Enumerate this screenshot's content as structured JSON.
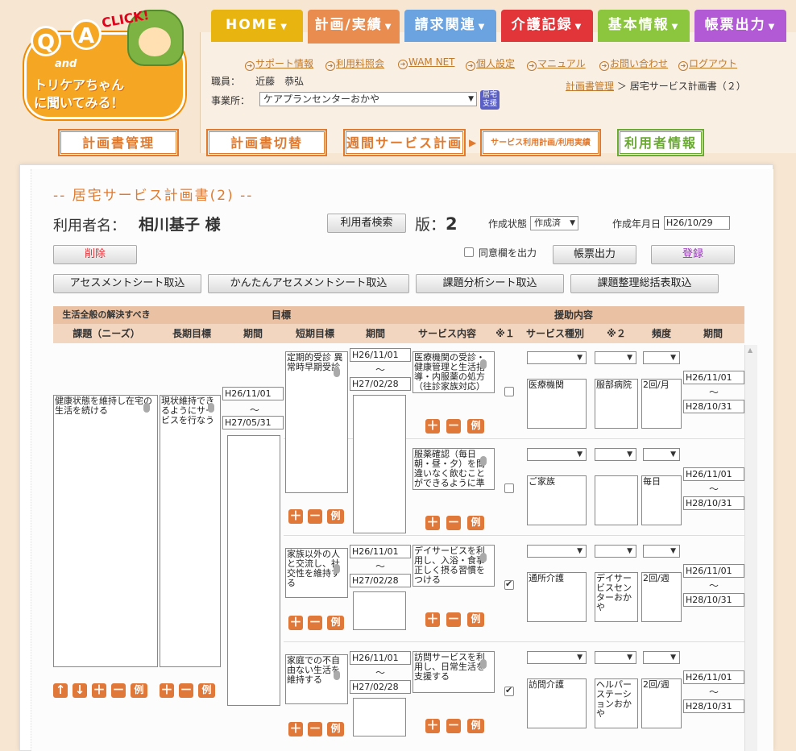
{
  "logo": {
    "q": "Q",
    "a": "A",
    "click": "CLICK!",
    "and": "and",
    "line1": "トリケアちゃん",
    "line2": "に聞いてみる！"
  },
  "tabs": [
    {
      "label": "HOME",
      "color": "#e8b410"
    },
    {
      "label": "計画/実績",
      "color": "#e98c4f"
    },
    {
      "label": "請求関連",
      "color": "#6aa3e0"
    },
    {
      "label": "介護記録",
      "color": "#e2353a"
    },
    {
      "label": "基本情報",
      "color": "#8cc63e"
    },
    {
      "label": "帳票出力",
      "color": "#b259d6"
    }
  ],
  "links": [
    "サポート情報",
    "利用料照会",
    "WAM NET",
    "個人設定",
    "マニュアル",
    "お問い合わせ",
    "ログアウト"
  ],
  "staff": {
    "label": "職員：",
    "name": "近藤　恭弘"
  },
  "office": {
    "label": "事業所：",
    "value": "ケアプランセンターおかや",
    "badge1": "居宅",
    "badge2": "支援"
  },
  "breadcrumb": {
    "parent": "計画書管理",
    "sep": "＞",
    "current": "居宅サービス計画書（２）"
  },
  "subnav": [
    "計画書管理",
    "計画書切替",
    "週間サービス計画",
    "サービス利用計画/利用実績",
    "利用者情報"
  ],
  "page": {
    "title": "-- 居宅サービス計画書(2) --",
    "user_label": "利用者名：",
    "user_name": "相川基子 様",
    "search_btn": "利用者検索",
    "ver_label": "版：",
    "ver": "2",
    "status_label": "作成状態",
    "status": "作成済",
    "date_label": "作成年月日",
    "date": "H26/10/29",
    "consent": "同意欄を出力",
    "print": "帳票出力",
    "delete": "削除",
    "register": "登録",
    "import1": "アセスメントシート取込",
    "import2": "かんたんアセスメントシート取込",
    "import3": "課題分析シート取込",
    "import4": "課題整理総括表取込"
  },
  "header": {
    "needs1": "生活全般の解決すべき",
    "needs2": "課題（ニーズ）",
    "goal": "目標",
    "long": "長期目標",
    "period": "期間",
    "short": "短期目標",
    "period2": "期間",
    "support": "援助内容",
    "service": "サービス内容",
    "n1": "※１",
    "type": "サービス種別",
    "n2": "※２",
    "freq": "頻度",
    "period3": "期間"
  },
  "need": {
    "text": "健康状態を維持し在宅の生活を続ける",
    "long": "現状維持できるようにサービスを行なう",
    "lp_from": "H26/11/01",
    "lp_tilde": "～",
    "lp_to": "H27/05/31"
  },
  "rows": [
    {
      "short": "定期的受診 異常時早期受診",
      "sp_from": "H26/11/01",
      "sp_to": "H27/02/28",
      "service": "医療機関の受診・健康管理と生活指導・内服薬の処方（往診家族対応）",
      "checked": false,
      "type": "医療機関",
      "provider": "服部病院",
      "freq": "2回/月",
      "p_from": "H26/11/01",
      "p_to": "H28/10/31"
    },
    {
      "short": "",
      "sp_from": "",
      "sp_to": "",
      "service": "服薬確認（毎日朝・昼・夕）を間違いなく飲むことができるように準",
      "checked": false,
      "type": "ご家族",
      "provider": "",
      "freq": "毎日",
      "p_from": "H26/11/01",
      "p_to": "H28/10/31"
    },
    {
      "short": "家族以外の人と交流し、社交性を維持する",
      "sp_from": "H26/11/01",
      "sp_to": "H27/02/28",
      "service": "デイサービスを利用し、入浴・食事正しく摂る習慣をつける",
      "checked": true,
      "type": "通所介護",
      "provider": "デイサービスセンターおかや",
      "freq": "2回/週",
      "p_from": "H26/11/01",
      "p_to": "H28/10/31"
    },
    {
      "short": "家庭での不自由ない生活を維持する",
      "sp_from": "H26/11/01",
      "sp_to": "H27/02/28",
      "service": "訪問サービスを利用し、日常生活を支援する",
      "checked": true,
      "type": "訪問介護",
      "provider": "ヘルパーステーションおかや",
      "freq": "2回/週",
      "p_from": "H26/11/01",
      "p_to": "H28/10/31"
    }
  ],
  "tilde": "～",
  "ctrl": {
    "plus": "＋",
    "minus": "－",
    "ex": "例",
    "up": "↑",
    "down": "↓"
  }
}
